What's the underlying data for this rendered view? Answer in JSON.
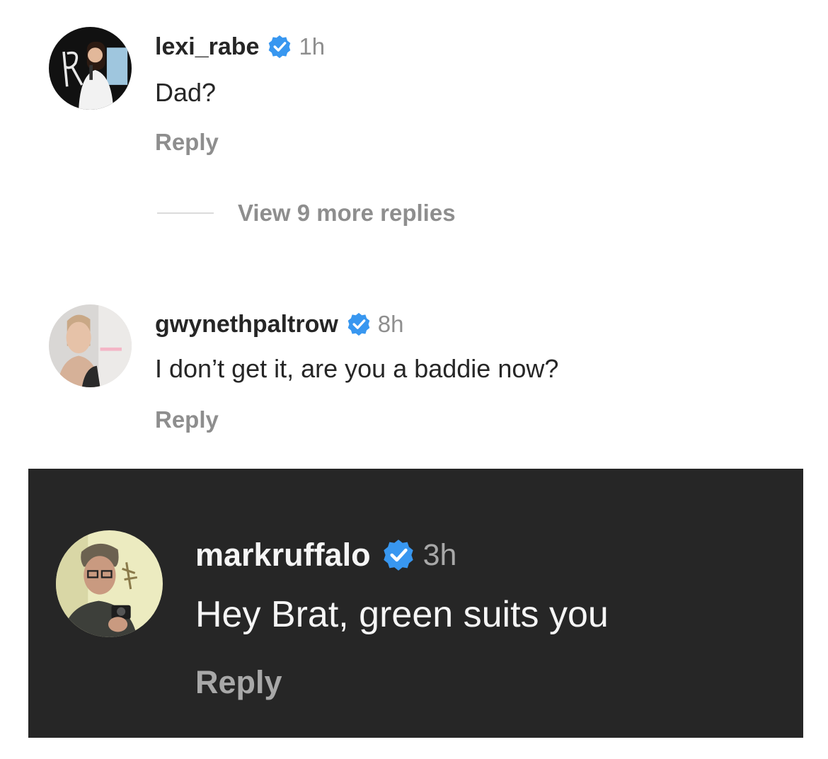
{
  "comments": [
    {
      "username": "lexi_rabe",
      "time": "1h",
      "text": "Dad?",
      "reply_label": "Reply"
    },
    {
      "username": "gwynethpaltrow",
      "time": "8h",
      "text": "I don’t get it, are you a baddie now?",
      "reply_label": "Reply"
    },
    {
      "username": "markruffalo",
      "time": "3h",
      "text": "Hey Brat, green suits you",
      "reply_label": "Reply"
    }
  ],
  "view_more": {
    "label": "View 9 more replies"
  },
  "colors": {
    "verified": "#3897f0",
    "text_dark": "#262626",
    "muted": "#8e8e8e",
    "dark_panel": "#262626"
  },
  "icons": {
    "verified": "verified-badge-icon"
  }
}
